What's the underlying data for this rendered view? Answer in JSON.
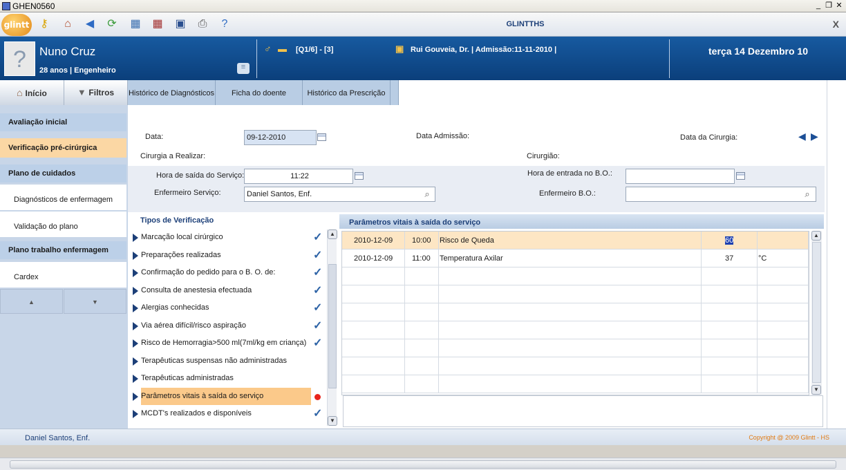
{
  "window": {
    "title": "GHEN0560",
    "app_title": "GLINTTHS",
    "logo_text": "glintt",
    "close_label": "X"
  },
  "patient": {
    "name": "Nuno Cruz",
    "info": "28 anos | Engenheiro",
    "bed": "[Q1/6] - [3]",
    "doctor": "Rui Gouveia, Dr. | Admissão:11-11-2010 |",
    "date": "terça 14 Dezembro 10"
  },
  "navtabs": {
    "inicio": "Início",
    "filtros": "Filtros",
    "tabs": [
      "Histórico de Diagnósticos",
      "Ficha do doente",
      "Histórico da Prescrição"
    ]
  },
  "sidebar": {
    "items": [
      "Avaliação inicial",
      "Verificação pré-cirúrgica",
      "Plano de cuidados",
      "Diagnósticos de enfermagem",
      "Validação do plano",
      "Plano trabalho enfermagem",
      "Cardex"
    ],
    "active": "Verificação pré-cirúrgica"
  },
  "form": {
    "data_label": "Data:",
    "data_value": "09-12-2010",
    "admissao_label": "Data Admissão:",
    "cirurgia_data_label": "Data da Cirurgia:",
    "cirurgia_label": "Cirurgia a Realizar:",
    "cirurgiao_label": "Cirurgião:",
    "hora_saida_label": "Hora de saída do Serviço:",
    "hora_saida_value": "11:22",
    "hora_entrada_label": "Hora de entrada no B.O.:",
    "hora_entrada_value": "",
    "enf_servico_label": "Enfermeiro Serviço:",
    "enf_servico_value": "Daniel Santos, Enf.",
    "enf_bo_label": "Enfermeiro B.O.:",
    "enf_bo_value": ""
  },
  "verificacao": {
    "title": "Tipos de Verificação",
    "items": [
      {
        "label": "Marcação local cirúrgico",
        "checked": true
      },
      {
        "label": "Preparações realizadas",
        "checked": true
      },
      {
        "label": "Confirmação do pedido para o B. O. de:",
        "checked": true
      },
      {
        "label": "Consulta de anestesia efectuada",
        "checked": true
      },
      {
        "label": "Alergias conhecidas",
        "checked": true
      },
      {
        "label": "Via aérea difícil/risco aspiração",
        "checked": true
      },
      {
        "label": "Risco de Hemorragia>500 ml(7ml/kg em criança)",
        "checked": true
      },
      {
        "label": "Terapêuticas suspensas não administradas",
        "checked": false
      },
      {
        "label": "Terapêuticas administradas",
        "checked": false
      },
      {
        "label": "Parâmetros vitais à saída do serviço",
        "checked": false,
        "selected": true
      },
      {
        "label": "MCDT's realizados e disponíveis",
        "checked": true
      }
    ]
  },
  "vitals": {
    "title": "Parâmetros vitais à saída do serviço",
    "rows": [
      {
        "date": "2010-12-09",
        "time": "10:00",
        "param": "Risco de Queda",
        "value": "60",
        "unit": ""
      },
      {
        "date": "2010-12-09",
        "time": "11:00",
        "param": "Temperatura Axilar",
        "value": "37",
        "unit": "°C"
      }
    ]
  },
  "status": {
    "user": "Daniel Santos, Enf.",
    "copyright": "Copyright @ 2009 Glintt - HS"
  },
  "colors": {
    "header": "#0f4a8a",
    "accent": "#fbc98a",
    "link": "#1c3f78",
    "check": "#2d63a6",
    "alert": "#e8241c"
  }
}
